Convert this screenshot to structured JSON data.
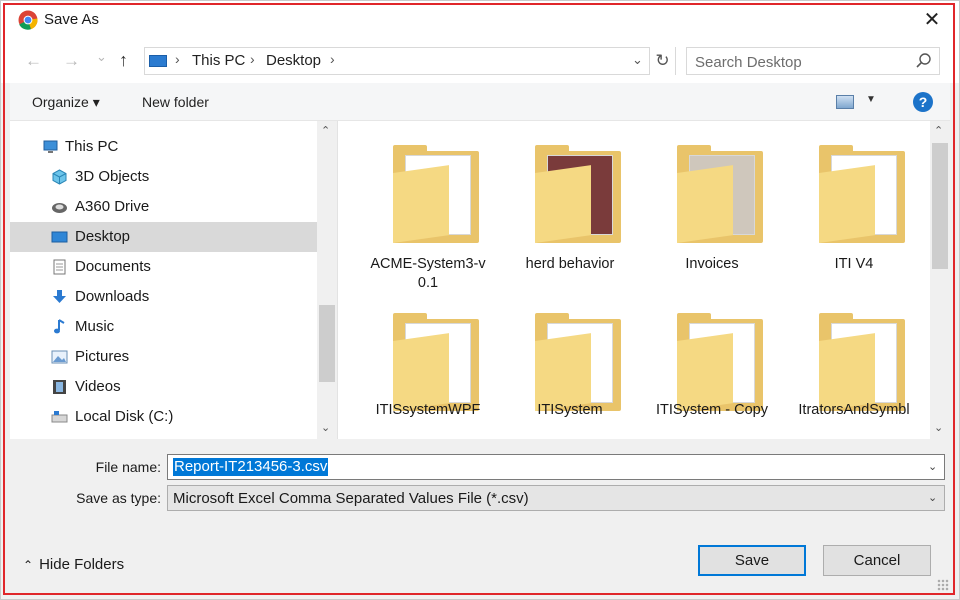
{
  "window": {
    "title": "Save As",
    "close_glyph": "✕",
    "app_icon": "chrome-icon"
  },
  "navigation": {
    "back_glyph": "←",
    "forward_glyph": "→",
    "recent_glyph": "⌄",
    "up_glyph": "↑",
    "breadcrumb": [
      "This PC",
      "Desktop"
    ],
    "separator": "›",
    "refresh_glyph": "↻",
    "search_placeholder": "Search Desktop"
  },
  "toolbar": {
    "organize": "Organize ▾",
    "new_folder": "New folder",
    "view_dropdown": "▼",
    "help": "?"
  },
  "sidebar": {
    "items": [
      {
        "label": "This PC",
        "icon": "computer-icon",
        "selected": false
      },
      {
        "label": "3D Objects",
        "icon": "cube-icon",
        "selected": false
      },
      {
        "label": "A360 Drive",
        "icon": "cloud-drive-icon",
        "selected": false
      },
      {
        "label": "Desktop",
        "icon": "desktop-icon",
        "selected": true
      },
      {
        "label": "Documents",
        "icon": "document-icon",
        "selected": false
      },
      {
        "label": "Downloads",
        "icon": "download-arrow-icon",
        "selected": false
      },
      {
        "label": "Music",
        "icon": "music-note-icon",
        "selected": false
      },
      {
        "label": "Pictures",
        "icon": "picture-icon",
        "selected": false
      },
      {
        "label": "Videos",
        "icon": "film-icon",
        "selected": false
      },
      {
        "label": "Local Disk (C:)",
        "icon": "disk-icon",
        "selected": false
      }
    ]
  },
  "files": [
    {
      "name": "ACME-System3-v 0.1",
      "icon": "folder-icon"
    },
    {
      "name": "herd behavior",
      "icon": "folder-icon"
    },
    {
      "name": "Invoices",
      "icon": "folder-icon"
    },
    {
      "name": "ITI V4",
      "icon": "folder-icon"
    },
    {
      "name": "ITISsystemWPF",
      "icon": "folder-icon"
    },
    {
      "name": "ITISystem",
      "icon": "folder-icon"
    },
    {
      "name": "ITISystem - Copy",
      "icon": "folder-icon"
    },
    {
      "name": "ItratorsAndSymbl",
      "icon": "folder-icon"
    }
  ],
  "form": {
    "file_name_label": "File name:",
    "file_name_value": "Report-IT213456-3.csv",
    "save_type_label": "Save as type:",
    "save_type_value": "Microsoft Excel Comma Separated Values File (*.csv)",
    "dropdown_glyph": "⌄"
  },
  "footer": {
    "hide_folders": "Hide Folders",
    "save": "Save",
    "cancel": "Cancel"
  },
  "colors": {
    "selection": "#0078d7",
    "sidebar_selected": "#d9d9d9",
    "folder": "#e9c46a"
  }
}
